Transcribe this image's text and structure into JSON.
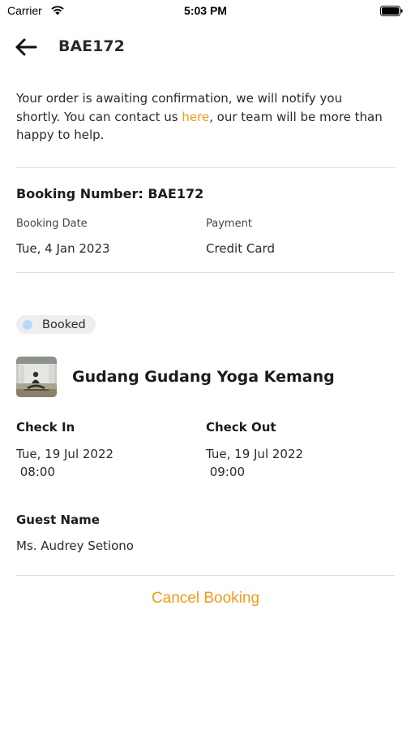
{
  "status_bar": {
    "carrier": "Carrier",
    "time": "5:03 PM"
  },
  "header": {
    "title": "BAE172",
    "back_icon": "arrow-left-icon"
  },
  "notice": {
    "text_before": "Your order is awaiting confirmation, we will notify you shortly. You can contact us ",
    "link_text": "here",
    "text_after": ", our team will be more than happy to help."
  },
  "booking": {
    "number_label": "Booking Number: BAE172",
    "date_label": "Booking Date",
    "date_value": "Tue, 4 Jan 2023",
    "payment_label": "Payment",
    "payment_value": "Credit Card"
  },
  "status": {
    "label": "Booked",
    "dot_color": "#b9daf7"
  },
  "venue": {
    "name": "Gudang Gudang Yoga Kemang"
  },
  "schedule": {
    "check_in_label": "Check In",
    "check_in_value": "Tue, 19 Jul 2022\n 08:00",
    "check_out_label": "Check Out",
    "check_out_value": "Tue, 19 Jul 2022\n 09:00"
  },
  "guest": {
    "label": "Guest Name",
    "value": "Ms. Audrey Setiono"
  },
  "actions": {
    "cancel_label": "Cancel Booking"
  },
  "colors": {
    "accent": "#f39a19",
    "divider": "#dedede",
    "pill_bg": "#eeeeef"
  }
}
